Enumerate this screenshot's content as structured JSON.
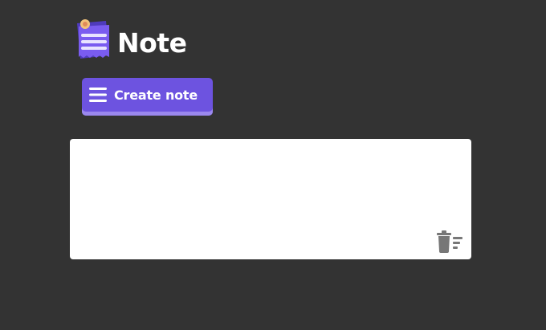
{
  "app": {
    "title": "Note",
    "logo_icon": "notepad-icon"
  },
  "toolbar": {
    "create_label": "Create note",
    "create_icon": "menu-lines-icon"
  },
  "notes": [
    {
      "content": "",
      "delete_icon": "delete-note-icon"
    }
  ],
  "colors": {
    "background": "#333333",
    "accent": "#6d53e0",
    "accent_light": "#9b88ee",
    "card": "#ffffff",
    "icon_gray": "#777777"
  }
}
